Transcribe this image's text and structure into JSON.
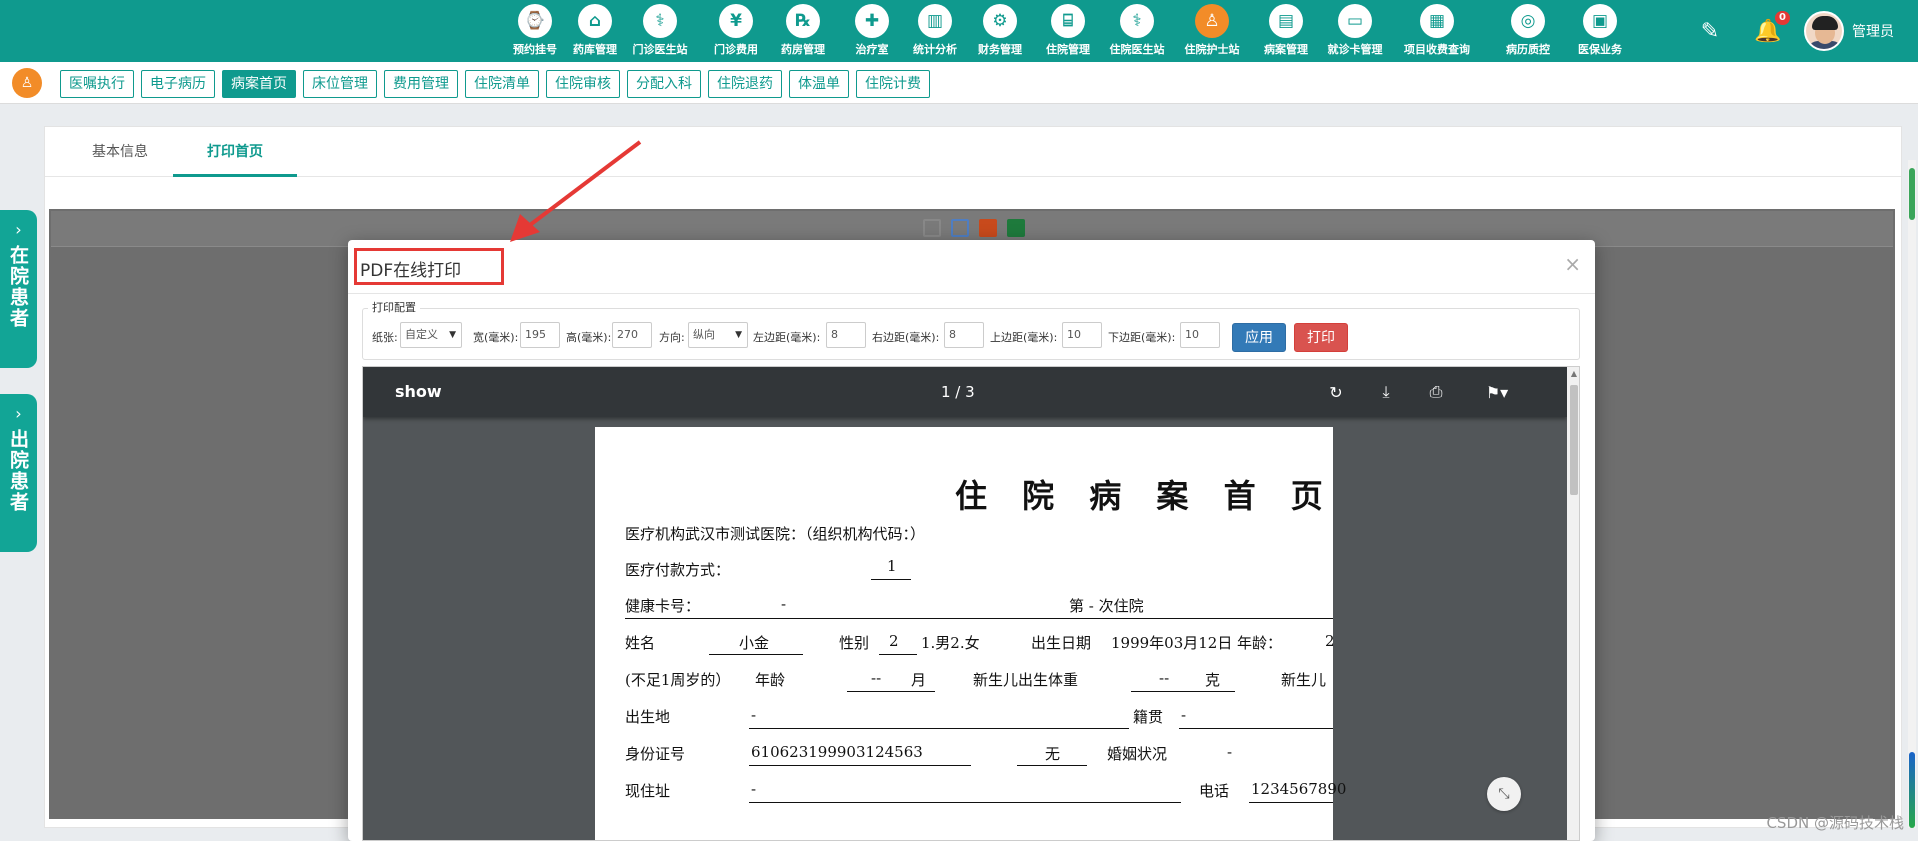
{
  "topnav": {
    "items": [
      {
        "label": "预约挂号",
        "glyph": "⌚"
      },
      {
        "label": "药库管理",
        "glyph": "⌂"
      },
      {
        "label": "门诊医生站",
        "glyph": "⚕"
      },
      {
        "label": "门诊费用",
        "glyph": "¥"
      },
      {
        "label": "药房管理",
        "glyph": "℞"
      },
      {
        "label": "治疗室",
        "glyph": "✚"
      },
      {
        "label": "统计分析",
        "glyph": "▥"
      },
      {
        "label": "财务管理",
        "glyph": "⚙"
      },
      {
        "label": "住院管理",
        "glyph": "⌸"
      },
      {
        "label": "住院医生站",
        "glyph": "⚕"
      },
      {
        "label": "住院护士站",
        "glyph": "♙"
      },
      {
        "label": "病案管理",
        "glyph": "▤"
      },
      {
        "label": "就诊卡管理",
        "glyph": "▭"
      },
      {
        "label": "项目收费查询",
        "glyph": "▦"
      },
      {
        "label": "病历质控",
        "glyph": "◎"
      },
      {
        "label": "医保业务",
        "glyph": "▣"
      }
    ],
    "active_index": 10,
    "notification_count": "0",
    "username": "管理员"
  },
  "subbar": {
    "tabs": [
      "医嘱执行",
      "电子病历",
      "病案首页",
      "床位管理",
      "费用管理",
      "住院清单",
      "住院审核",
      "分配入科",
      "住院退药",
      "体温单",
      "住院计费"
    ],
    "active_index": 2
  },
  "side": {
    "inpatients": "在院患者",
    "discharged": "出院患者"
  },
  "panel": {
    "tab_basic": "基本信息",
    "tab_print": "打印首页"
  },
  "modal": {
    "title": "PDF在线打印",
    "close": "×",
    "config_legend": "打印配置",
    "paper_label": "纸张:",
    "paper_value": "自定义",
    "width_label": "宽(毫米):",
    "width_value": "195",
    "height_label": "高(毫米):",
    "height_value": "270",
    "orientation_label": "方向:",
    "orientation_value": "纵向",
    "left_label": "左边距(毫米):",
    "left_value": "8",
    "right_label": "右边距(毫米):",
    "right_value": "8",
    "top_label": "上边距(毫米):",
    "top_value": "10",
    "bottom_label": "下边距(毫米):",
    "bottom_value": "10",
    "apply": "应用",
    "print": "打印"
  },
  "pdf": {
    "name": "show",
    "page_indicator": "1 / 3",
    "title": "住 院 病 案 首 页",
    "line1": "医疗机构武汉市测试医院：（组织机构代码：）",
    "pay_label": "医疗付款方式：",
    "pay_value": "1",
    "card_label": "健康卡号：",
    "card_value": "-",
    "visit": "第 - 次住院",
    "name_label": "姓名",
    "name_value": "小金",
    "sex_label": "性别",
    "sex_value": "2",
    "sex_note": "1.男2.女",
    "birth_label": "出生日期",
    "birth_value": "1999年03月12日",
    "age_label": "年龄：",
    "age_value": "2",
    "infant_label": "(不足1周岁的）",
    "infant_age_label": "年龄",
    "infant_age_value": "--",
    "month_unit": "月",
    "newborn_weight_label": "新生儿出生体重",
    "newborn_weight_value": "--",
    "gram_unit": "克",
    "newborn_label2": "新生儿",
    "birthplace_label": "出生地",
    "birthplace_value": "-",
    "native_label": "籍贯",
    "native_value": "-",
    "id_label": "身份证号",
    "id_value": "610623199903124563",
    "occupation_value": "无",
    "marital_label": "婚姻状况",
    "marital_value": "-",
    "address_label": "现住址",
    "address_value": "-",
    "phone_label": "电话",
    "phone_value": "1234567890"
  },
  "watermark": "CSDN @源码技术栈",
  "colors": {
    "primary": "#0f9a8e",
    "accent": "#f28c28",
    "danger": "#e53935"
  }
}
